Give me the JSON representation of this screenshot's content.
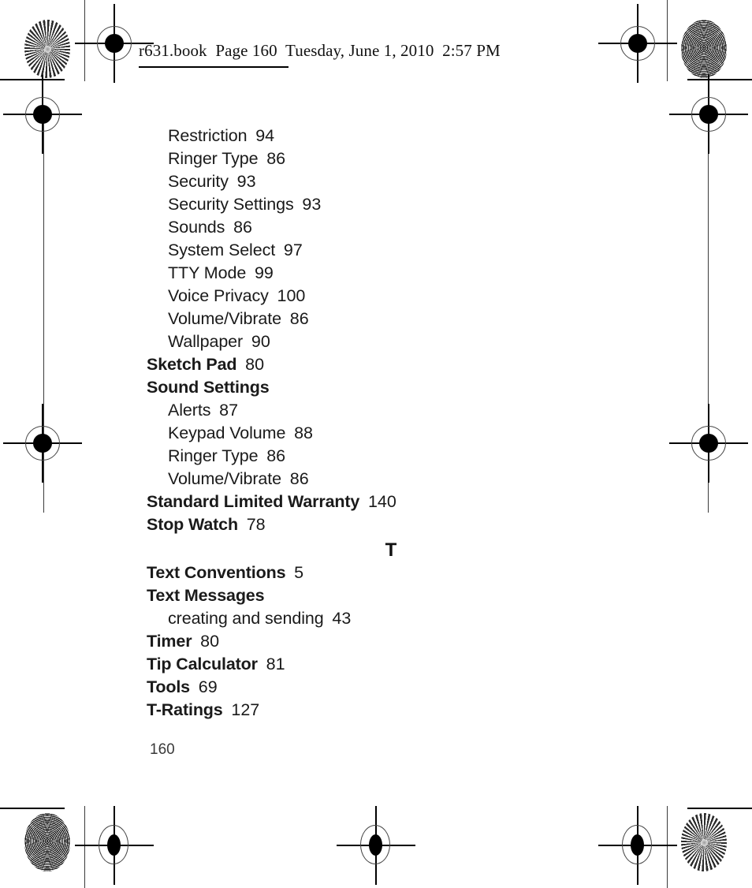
{
  "document": {
    "header_slug": "r631.book  Page 160  Tuesday, June 1, 2010  2:57 PM",
    "folio": "160",
    "page_number": 160
  },
  "index": {
    "continued_subentries": [
      {
        "label": "Restriction",
        "page": "94"
      },
      {
        "label": "Ringer Type",
        "page": "86"
      },
      {
        "label": "Security",
        "page": "93"
      },
      {
        "label": "Security Settings",
        "page": "93"
      },
      {
        "label": "Sounds",
        "page": "86"
      },
      {
        "label": "System Select",
        "page": "97"
      },
      {
        "label": "TTY Mode",
        "page": "99"
      },
      {
        "label": "Voice Privacy",
        "page": "100"
      },
      {
        "label": "Volume/Vibrate",
        "page": "86"
      },
      {
        "label": "Wallpaper",
        "page": "90"
      }
    ],
    "entries_s": [
      {
        "label": "Sketch Pad",
        "page": "80"
      },
      {
        "label": "Sound Settings",
        "page": ""
      },
      {
        "label": "Alerts",
        "page": "87",
        "sub": true
      },
      {
        "label": "Keypad Volume",
        "page": "88",
        "sub": true
      },
      {
        "label": "Ringer Type",
        "page": "86",
        "sub": true
      },
      {
        "label": "Volume/Vibrate",
        "page": "86",
        "sub": true
      },
      {
        "label": "Standard Limited Warranty",
        "page": "140"
      },
      {
        "label": "Stop Watch",
        "page": "78"
      }
    ],
    "section_letter_t": "T",
    "entries_t": [
      {
        "label": "Text Conventions",
        "page": "5"
      },
      {
        "label": "Text Messages",
        "page": ""
      },
      {
        "label": "creating and sending",
        "page": "43",
        "sub": true
      },
      {
        "label": "Timer",
        "page": "80"
      },
      {
        "label": "Tip Calculator",
        "page": "81"
      },
      {
        "label": "Tools",
        "page": "69"
      },
      {
        "label": "T-Ratings",
        "page": "127"
      }
    ]
  },
  "prepress_marks": {
    "registration_mark_label": "registration-target",
    "star_target_label": "radial-resolution-target",
    "moire_target_label": "concentric-ring-target",
    "ink_color": "#000000"
  }
}
